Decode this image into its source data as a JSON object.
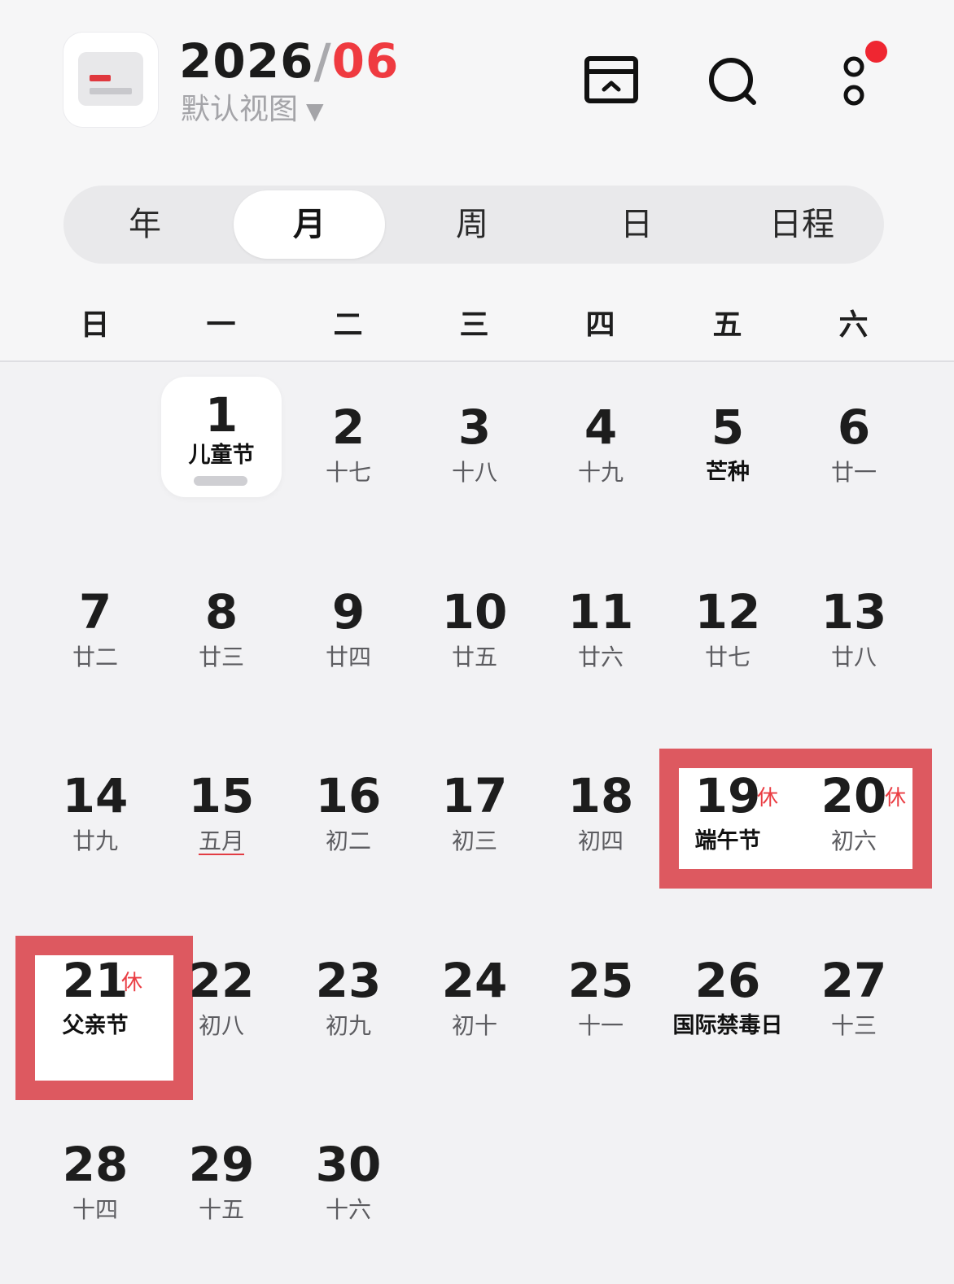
{
  "header": {
    "year": "2026",
    "separator": "/",
    "month": "06",
    "view_label": "默认视图",
    "view_dropdown": "▼",
    "accent_color": "#ef3a40",
    "icons": [
      "calendar-app-icon",
      "fold-view-icon",
      "search-icon",
      "more-options-icon"
    ]
  },
  "tabs": [
    {
      "label": "年",
      "active": false
    },
    {
      "label": "月",
      "active": true
    },
    {
      "label": "周",
      "active": false
    },
    {
      "label": "日",
      "active": false
    },
    {
      "label": "日程",
      "active": false
    }
  ],
  "weekdays": [
    "日",
    "一",
    "二",
    "三",
    "四",
    "五",
    "六"
  ],
  "days": [
    {
      "day": "1",
      "lunar": "儿童节",
      "festival": true,
      "today": true
    },
    {
      "day": "2",
      "lunar": "十七"
    },
    {
      "day": "3",
      "lunar": "十八"
    },
    {
      "day": "4",
      "lunar": "十九"
    },
    {
      "day": "5",
      "lunar": "芒种",
      "festival": true
    },
    {
      "day": "6",
      "lunar": "廿一"
    },
    {
      "day": "7",
      "lunar": "廿二"
    },
    {
      "day": "8",
      "lunar": "廿三"
    },
    {
      "day": "9",
      "lunar": "廿四"
    },
    {
      "day": "10",
      "lunar": "廿五"
    },
    {
      "day": "11",
      "lunar": "廿六"
    },
    {
      "day": "12",
      "lunar": "廿七"
    },
    {
      "day": "13",
      "lunar": "廿八"
    },
    {
      "day": "14",
      "lunar": "廿九"
    },
    {
      "day": "15",
      "lunar": "五月",
      "month_start": true
    },
    {
      "day": "16",
      "lunar": "初二"
    },
    {
      "day": "17",
      "lunar": "初三"
    },
    {
      "day": "18",
      "lunar": "初四"
    },
    {
      "day": "19",
      "lunar": "端午节",
      "festival": true,
      "rest": "休"
    },
    {
      "day": "20",
      "lunar": "初六",
      "rest": "休"
    },
    {
      "day": "21",
      "lunar": "父亲节",
      "festival": true,
      "rest": "休"
    },
    {
      "day": "22",
      "lunar": "初八"
    },
    {
      "day": "23",
      "lunar": "初九"
    },
    {
      "day": "24",
      "lunar": "初十"
    },
    {
      "day": "25",
      "lunar": "十一"
    },
    {
      "day": "26",
      "lunar": "国际禁毒日",
      "festival": true
    },
    {
      "day": "27",
      "lunar": "十三"
    },
    {
      "day": "28",
      "lunar": "十四"
    },
    {
      "day": "29",
      "lunar": "十五"
    },
    {
      "day": "30",
      "lunar": "十六"
    }
  ]
}
